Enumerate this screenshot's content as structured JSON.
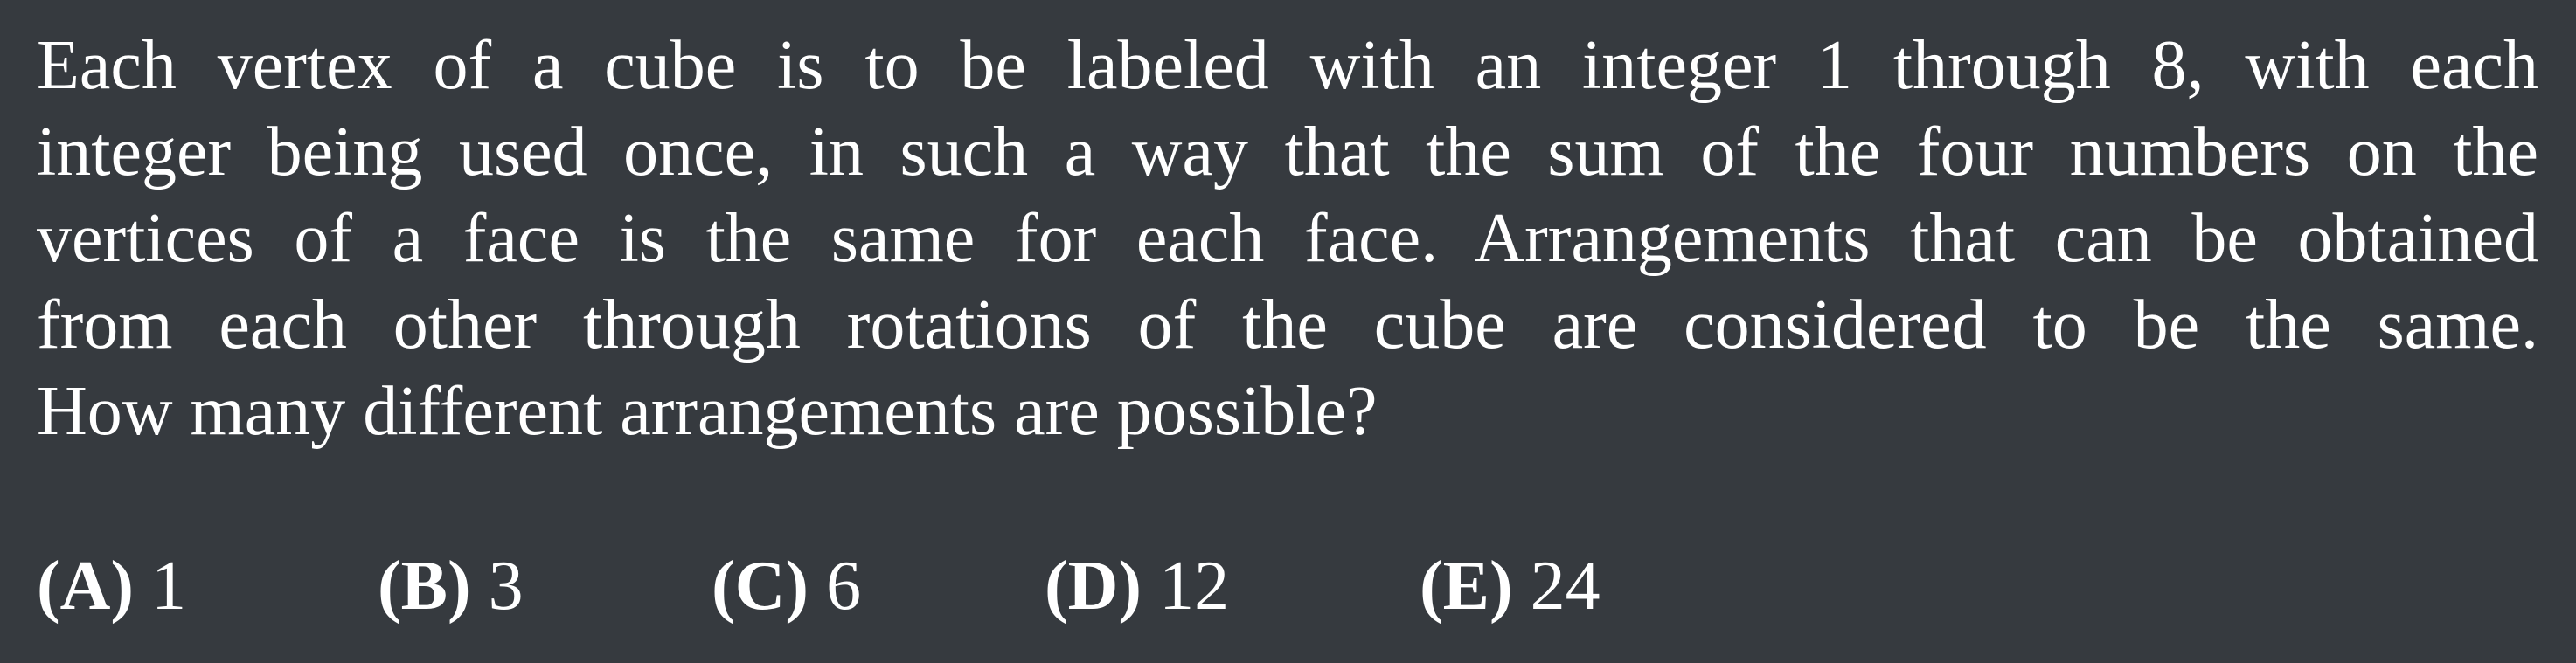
{
  "problem": {
    "lines": [
      "Each vertex of a cube is to be labeled with an integer 1 through 8, with each",
      "integer being used once, in such a way that the sum of the four numbers on the",
      "vertices of a face is the same for each face. Arrangements that can be obtained",
      "from each other through rotations of the cube are considered to be the same.",
      "How many different arrangements are possible?"
    ]
  },
  "choices": [
    {
      "letter": "(A)",
      "value": "1"
    },
    {
      "letter": "(B)",
      "value": "3"
    },
    {
      "letter": "(C)",
      "value": "6"
    },
    {
      "letter": "(D)",
      "value": "12"
    },
    {
      "letter": "(E)",
      "value": "24"
    }
  ],
  "colors": {
    "background": "#363a3f",
    "text": "#ffffff"
  }
}
